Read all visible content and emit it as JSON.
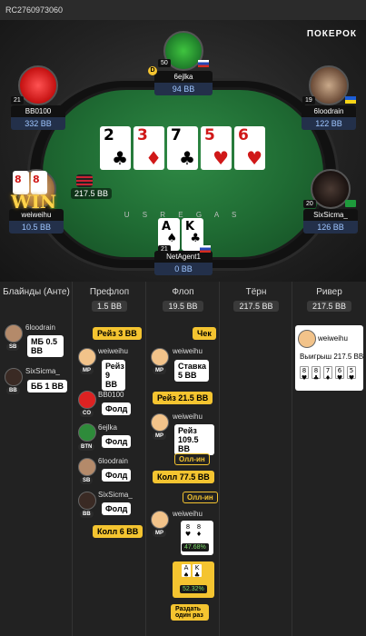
{
  "hand_id": "RC2760973060",
  "brand": "ПОКЕРОК",
  "felt_text": "U S   R E G A S",
  "board": [
    {
      "rank": "2",
      "suit": "♣",
      "color": "black"
    },
    {
      "rank": "3",
      "suit": "♦",
      "color": "red"
    },
    {
      "rank": "7",
      "suit": "♣",
      "color": "black"
    },
    {
      "rank": "5",
      "suit": "♥",
      "color": "red"
    },
    {
      "rank": "6",
      "suit": "♥",
      "color": "red"
    }
  ],
  "players": {
    "top": {
      "name": "6ejlka",
      "stack": "94 BB",
      "level": "50",
      "dealer": "D"
    },
    "left_top": {
      "name": "BB0100",
      "stack": "332 BB",
      "level": "21"
    },
    "right_top": {
      "name": "6loodrain",
      "stack": "122 BB",
      "level": "19"
    },
    "left_bottom": {
      "name": "weiweihu",
      "stack": "10.5 BB",
      "pot": "217.5 BB",
      "hole": [
        "8",
        "8"
      ],
      "win": "WIN"
    },
    "right_bottom": {
      "name": "SixSicma_",
      "stack": "126 BB",
      "level": "20"
    },
    "hero": {
      "name": "NetAgent1",
      "stack": "0 BB",
      "level": "21",
      "hole": [
        {
          "rank": "A",
          "suit": "♠"
        },
        {
          "rank": "K",
          "suit": "♣"
        }
      ]
    }
  },
  "streets": {
    "blinds": {
      "title": "Блайнды (Анте)"
    },
    "preflop": {
      "title": "Префлоп",
      "pot": "1.5 BB"
    },
    "flop": {
      "title": "Флоп",
      "pot": "19.5 BB"
    },
    "turn": {
      "title": "Тёрн",
      "pot": "217.5 BB"
    },
    "river": {
      "title": "Ривер",
      "pot": "217.5 BB"
    }
  },
  "blinds_actions": [
    {
      "name": "6loodrain",
      "pos": "SB",
      "action": "МБ 0.5 BB"
    },
    {
      "name": "SixSicma_",
      "pos": "BB",
      "action": "ББ 1 BB"
    }
  ],
  "preflop_actions": {
    "raise1": "Рейз 3 BB",
    "weiweihu": {
      "name": "weiweihu",
      "pos": "MP",
      "action": "Рейз 9 BB"
    },
    "bb0100": {
      "name": "BB0100",
      "pos": "CO",
      "action": "Фолд"
    },
    "6ejlka": {
      "name": "6ejlka",
      "pos": "BTN",
      "action": "Фолд"
    },
    "6loodrain": {
      "name": "6loodrain",
      "pos": "SB",
      "action": "Фолд"
    },
    "sixsicma": {
      "name": "SixSicma_",
      "pos": "BB",
      "action": "Фолд"
    },
    "call": "Колл 6 BB"
  },
  "flop_actions": {
    "check": "Чек",
    "bet": {
      "name": "weiweihu",
      "pos": "MP",
      "action": "Ставка 5 BB"
    },
    "raise": "Рейз 21.5 BB",
    "reraise": {
      "name": "weiweihu",
      "pos": "MP",
      "action": "Рейз 109.5 BB"
    },
    "allin1": "Олл-ин",
    "call": "Колл 77.5 BB",
    "allin2": "Олл-ин",
    "show": {
      "name": "weiweihu",
      "pos": "MP",
      "equity": "47.68%"
    },
    "hero_equity": "52.32%",
    "runtwice": "Раздать один раз"
  },
  "river_actions": {
    "name": "weiweihu",
    "win": "Выигрыш 217.5 BB"
  }
}
